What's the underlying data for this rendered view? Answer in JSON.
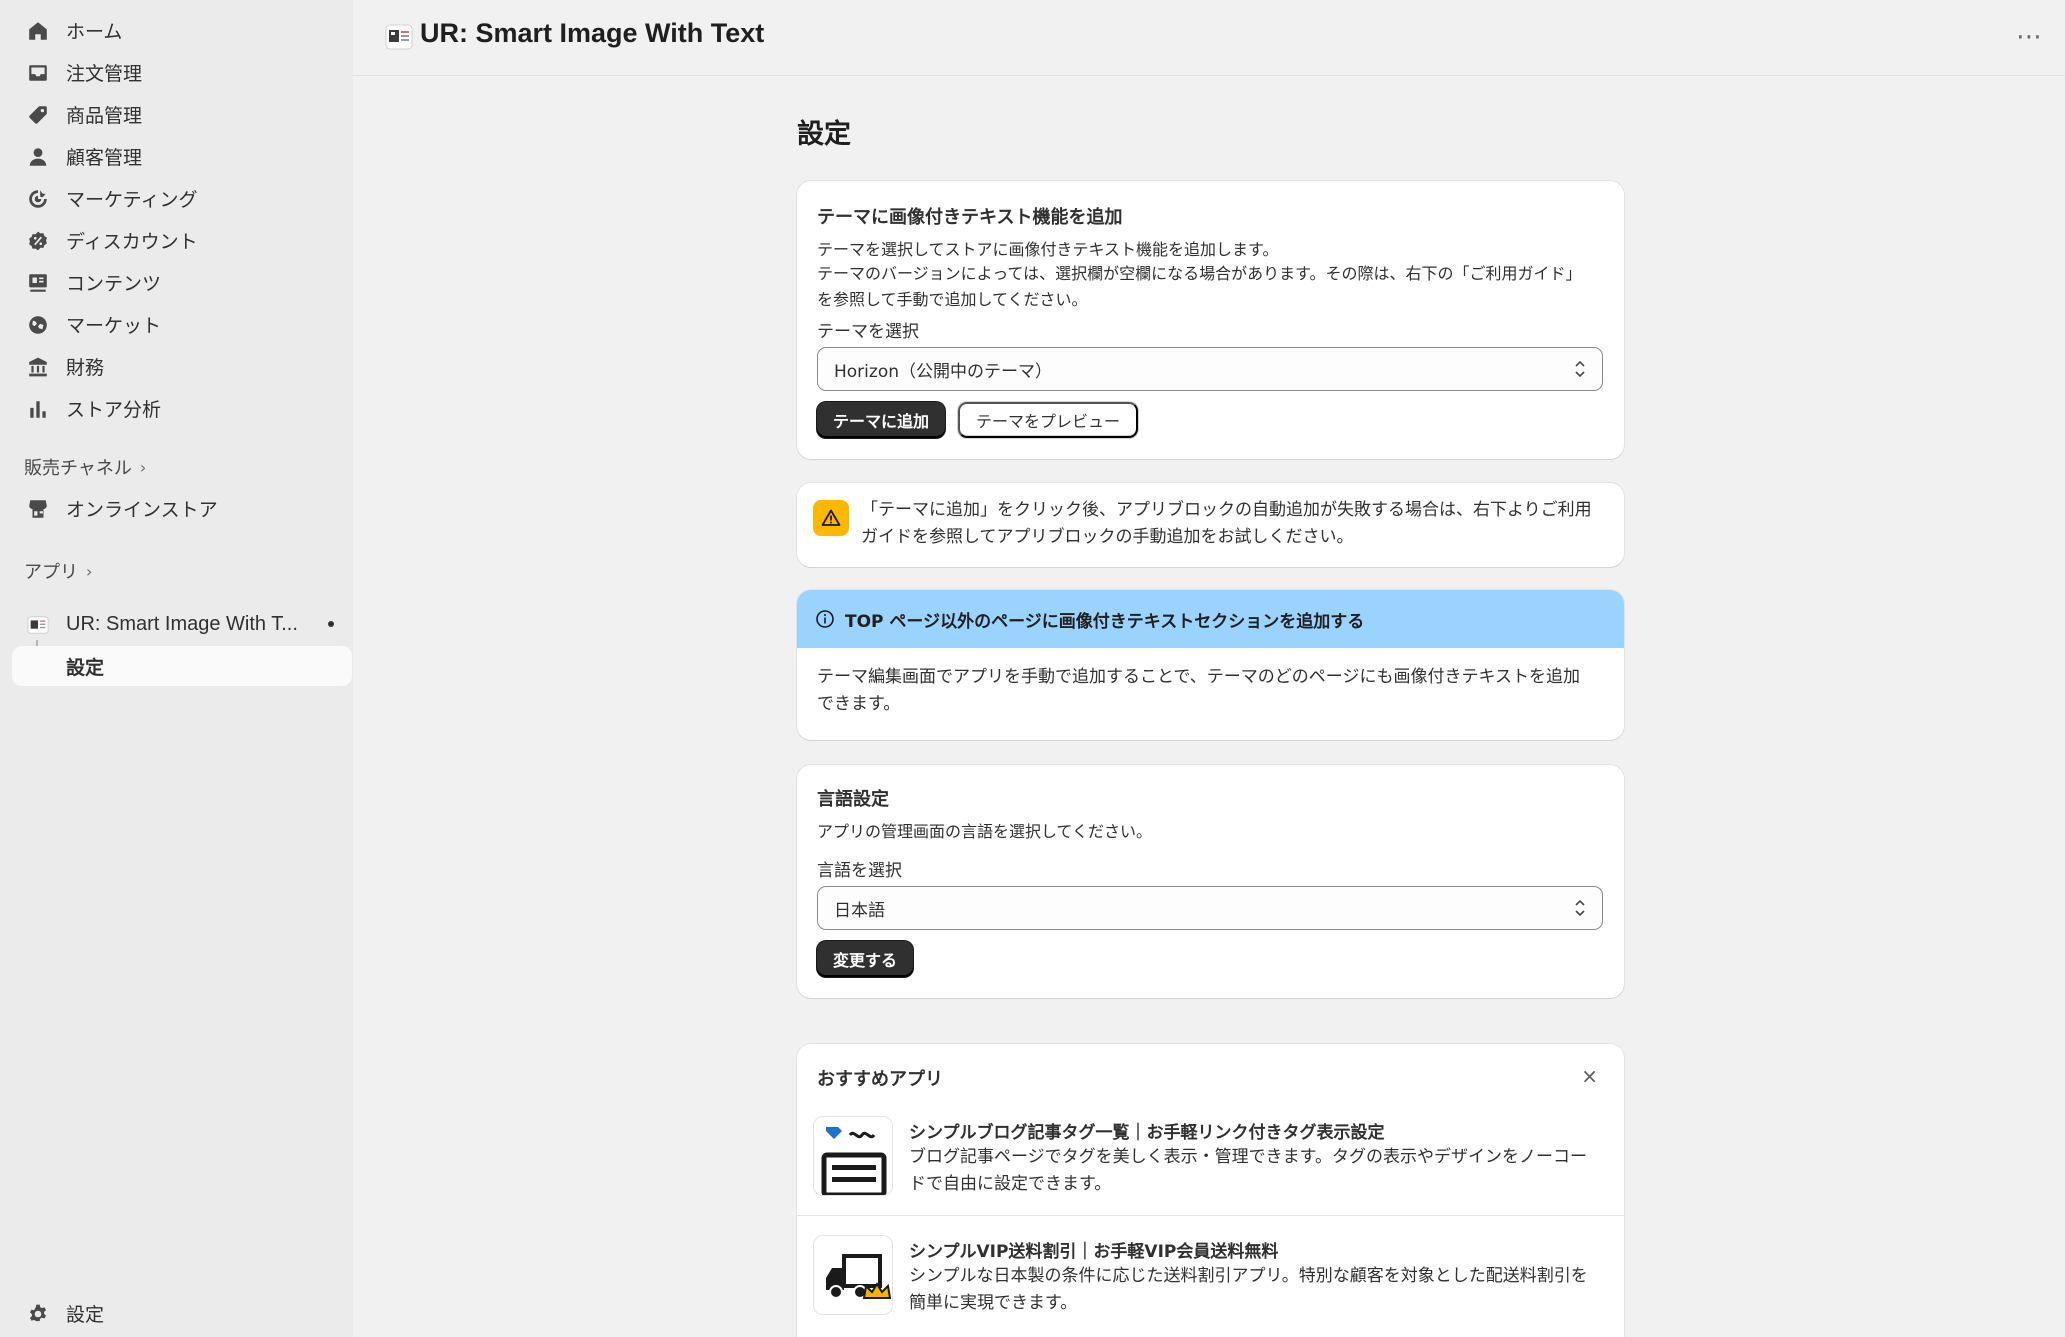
{
  "sidebar": {
    "items": [
      {
        "label": "ホーム",
        "icon": "home-icon"
      },
      {
        "label": "注文管理",
        "icon": "inbox-icon"
      },
      {
        "label": "商品管理",
        "icon": "tag-icon"
      },
      {
        "label": "顧客管理",
        "icon": "person-icon"
      },
      {
        "label": "マーケティング",
        "icon": "target-icon"
      },
      {
        "label": "ディスカウント",
        "icon": "discount-icon"
      },
      {
        "label": "コンテンツ",
        "icon": "content-icon"
      },
      {
        "label": "マーケット",
        "icon": "globe-icon"
      },
      {
        "label": "財務",
        "icon": "bank-icon"
      },
      {
        "label": "ストア分析",
        "icon": "bar-chart-icon"
      }
    ],
    "sales_channels_label": "販売チャネル",
    "online_store_label": "オンラインストア",
    "apps_label": "アプリ",
    "app_name": "UR: Smart Image With T...",
    "app_settings_label": "設定",
    "settings_label": "設定"
  },
  "header": {
    "app_title": "UR: Smart Image With Text",
    "more": "⋯"
  },
  "page": {
    "title": "設定"
  },
  "theme_card": {
    "title": "テーマに画像付きテキスト機能を追加",
    "description_line1": "テーマを選択してストアに画像付きテキスト機能を追加します。",
    "description_line2": "テーマのバージョンによっては、選択欄が空欄になる場合があります。その際は、右下の「ご利用ガイド」を参照して手動で追加してください。",
    "select_label": "テーマを選択",
    "select_value": "Horizon（公開中のテーマ）",
    "add_button": "テーマに追加",
    "preview_button": "テーマをプレビュー"
  },
  "warning_card": {
    "text": "「テーマに追加」をクリック後、アプリブロックの自動追加が失敗する場合は、右下よりご利用ガイドを参照してアプリブロックの手動追加をお試しください。"
  },
  "info_card": {
    "banner": "TOP ページ以外のページに画像付きテキストセクションを追加する",
    "text": "テーマ編集画面でアプリを手動で追加することで、テーマのどのページにも画像付きテキストを追加できます。"
  },
  "language_card": {
    "title": "言語設定",
    "description": "アプリの管理画面の言語を選択してください。",
    "select_label": "言語を選択",
    "select_value": "日本語",
    "change_button": "変更する"
  },
  "recommend_card": {
    "title": "おすすめアプリ",
    "close": "×",
    "apps": [
      {
        "name": "シンプルブログ記事タグ一覧｜お手軽リンク付きタグ表示設定",
        "description": "ブログ記事ページでタグを美しく表示・管理できます。タグの表示やデザインをノーコードで自由に設定できます。"
      },
      {
        "name": "シンプルVIP送料割引｜お手軽VIP会員送料無料",
        "description": "シンプルな日本製の条件に応じた送料割引アプリ。特別な顧客を対象とした配送料割引を簡単に実現できます。"
      }
    ]
  },
  "colors": {
    "sidebar_bg": "#ebebeb",
    "main_bg": "#f1f1f1",
    "primary_button": "#303030",
    "warning": "#ffb800",
    "info_banner": "#9bd3ff"
  }
}
